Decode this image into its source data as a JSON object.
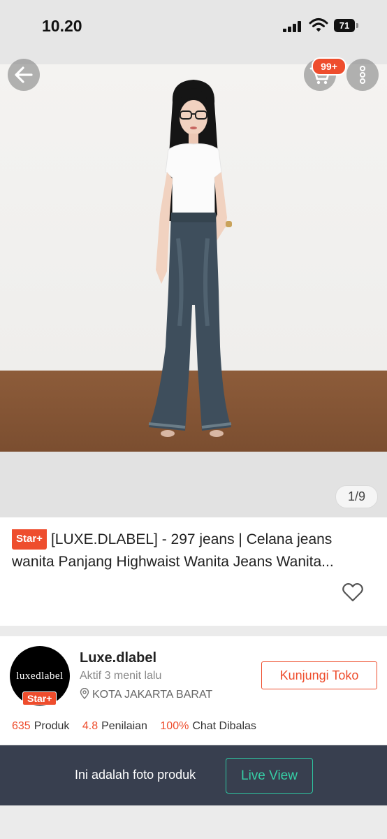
{
  "status_bar": {
    "time": "10.20",
    "battery": "71"
  },
  "header": {
    "cart_badge": "99+",
    "image_counter": "1/9"
  },
  "product": {
    "badge": "Star+",
    "title_line1": "[LUXE.DLABEL] - 297 jeans  | Celana jeans",
    "title_line2": "wanita  Panjang Highwaist Wanita Jeans Wanita..."
  },
  "shop": {
    "avatar_text": "luxedlabel",
    "badge": "Star+",
    "name": "Luxe.dlabel",
    "active": "Aktif 3 menit lalu",
    "location": "KOTA JAKARTA BARAT",
    "visit_label": "Kunjungi Toko",
    "stats": [
      {
        "value": "635",
        "label": "Produk"
      },
      {
        "value": "4.8",
        "label": "Penilaian"
      },
      {
        "value": "100%",
        "label": "Chat Dibalas"
      }
    ]
  },
  "bottom_bar": {
    "text": "Ini adalah foto produk",
    "live_label": "Live View"
  },
  "colors": {
    "accent": "#ee4d2d",
    "live_green": "#36cfa6",
    "bar_bg": "#383f4f"
  }
}
